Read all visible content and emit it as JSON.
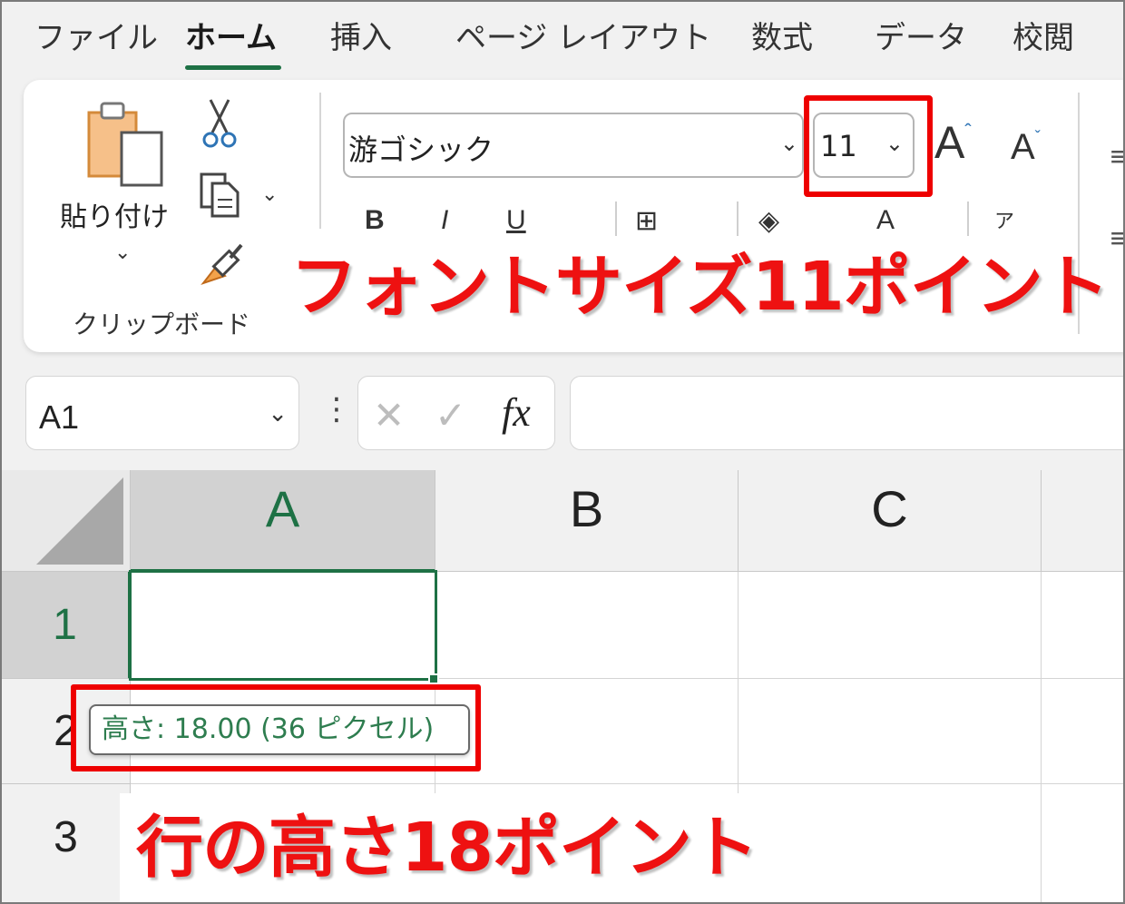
{
  "menu": {
    "tabs": [
      "ファイル",
      "ホーム",
      "挿入",
      "ページ レイアウト",
      "数式",
      "データ",
      "校閲"
    ],
    "active_tab": "ホーム"
  },
  "ribbon": {
    "clipboard": {
      "paste_label": "貼り付け",
      "group_label": "クリップボード"
    },
    "font": {
      "name": "游ゴシック",
      "size": "11",
      "format_buttons": [
        "B",
        "I",
        "U"
      ]
    }
  },
  "formula_bar": {
    "name_box": "A1",
    "fx_label": "fx",
    "formula": ""
  },
  "sheet": {
    "columns": [
      "A",
      "B",
      "C"
    ],
    "rows": [
      "1",
      "2",
      "3"
    ],
    "active_cell": "A1",
    "row_height_tooltip": "高さ: 18.00 (36 ピクセル)"
  },
  "annotations": {
    "font_size_note": "フォントサイズ11ポイント",
    "row_height_note": "行の高さ18ポイント",
    "accent_color": "#ee1111",
    "excel_green": "#1e7145"
  }
}
